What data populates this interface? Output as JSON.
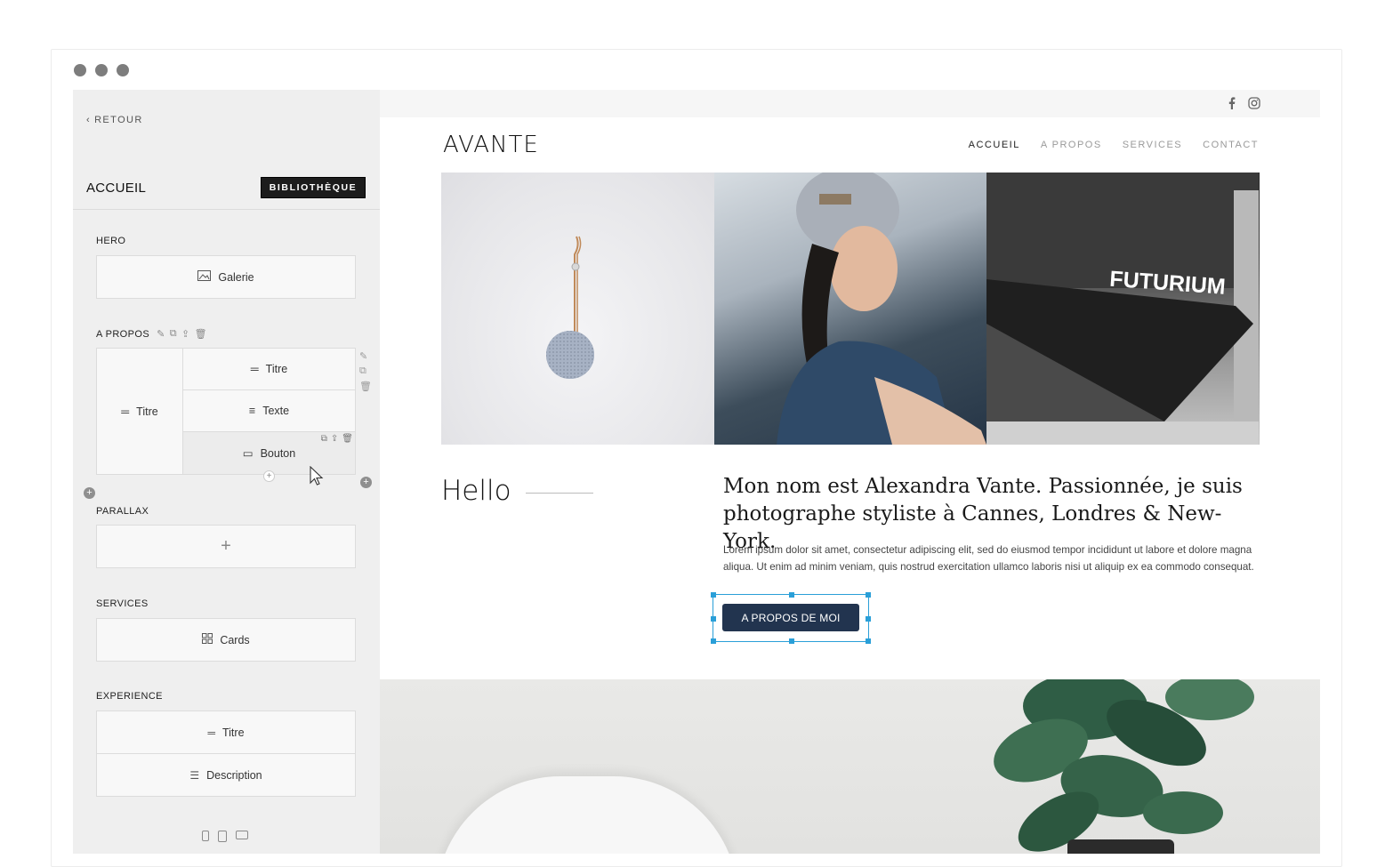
{
  "sidebar": {
    "back_label": "RETOUR",
    "page_title": "ACCUEIL",
    "library_button": "BIBLIOTHÈQUE",
    "sections": {
      "hero": {
        "label": "HERO",
        "item": "Galerie"
      },
      "apropos": {
        "label": "A PROPOS",
        "left_item": "Titre",
        "items": [
          "Titre",
          "Texte",
          "Bouton"
        ]
      },
      "parallax": {
        "label": "PARALLAX",
        "add": "+"
      },
      "services": {
        "label": "SERVICES",
        "item": "Cards"
      },
      "experience": {
        "label": "EXPERIENCE",
        "items": [
          "Titre",
          "Description"
        ]
      }
    }
  },
  "site": {
    "logo": "AVANTE",
    "nav": [
      "ACCUEIL",
      "A PROPOS",
      "SERVICES",
      "CONTACT"
    ],
    "active_nav": "ACCUEIL",
    "gallery_sign": "FUTURIUM",
    "hello": "Hello",
    "intro": "Mon nom est Alexandra Vante. Passionnée, je suis photographe styliste à Cannes, Londres & New-York.",
    "lorem": "Lorem ipsum dolor sit amet, consectetur adipiscing elit, sed do eiusmod tempor incididunt ut labore et dolore magna aliqua. Ut enim ad minim veniam, quis nostrud exercitation ullamco laboris nisi ut aliquip ex ea commodo consequat.",
    "cta": "A PROPOS DE MOI"
  },
  "icons": {
    "social": [
      "facebook-icon",
      "instagram-icon"
    ],
    "devices": [
      "mobile-icon",
      "tablet-icon",
      "desktop-icon"
    ]
  },
  "colors": {
    "sidebar_bg": "#efefef",
    "cta_bg": "#22344f",
    "selection": "#2a9fd8"
  }
}
